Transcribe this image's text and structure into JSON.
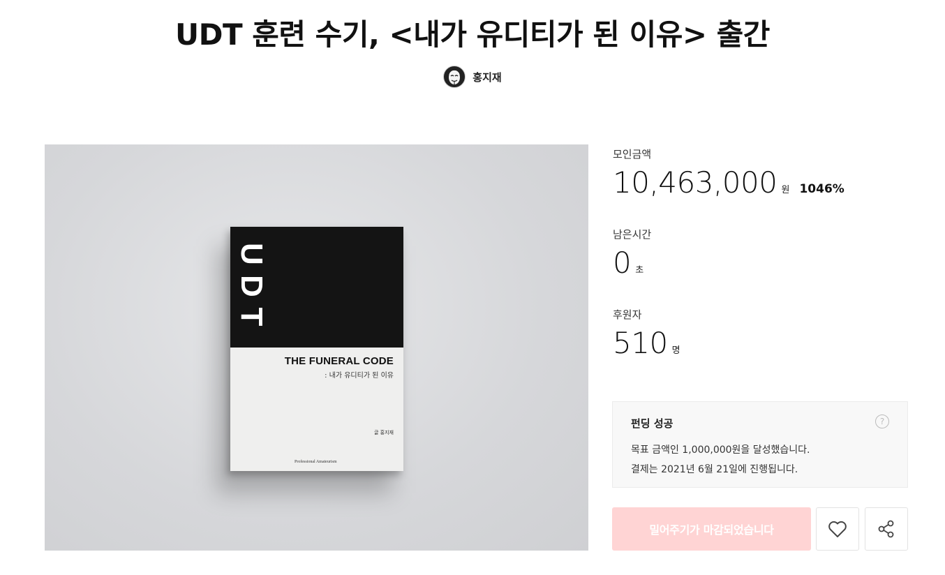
{
  "page_title": "UDT 훈련 수기, <내가 유디티가 된 이유> 출간",
  "creator": {
    "name": "홍지재",
    "avatar_icon": "mask-avatar-icon"
  },
  "cover": {
    "udt_letters": [
      "U",
      "D",
      "T"
    ],
    "english_title": "THE FUNERAL CODE",
    "korean_subtitle": ": 내가 유디티가 된 이유",
    "author_line": "글 홍지재",
    "publisher_line": "Professional Amateurism"
  },
  "stats": {
    "raised_label": "모인금액",
    "raised_value": "10,463,000",
    "raised_unit": "원",
    "raised_percent": "1046%",
    "time_label": "남은시간",
    "time_value": "0",
    "time_unit": "초",
    "backers_label": "후원자",
    "backers_value": "510",
    "backers_unit": "명"
  },
  "result": {
    "title": "펀딩 성공",
    "help_icon": "help-circle-icon",
    "line1": "목표 금액인 1,000,000원을 달성했습니다.",
    "line2": "결제는 2021년 6월 21일에 진행됩니다."
  },
  "actions": {
    "push_label": "밀어주기가 마감되었습니다",
    "like_icon": "heart-icon",
    "share_icon": "share-icon"
  },
  "colors": {
    "button_disabled": "#ffd4d4",
    "cover_background": "#d6d7da",
    "book_top": "#141414"
  }
}
